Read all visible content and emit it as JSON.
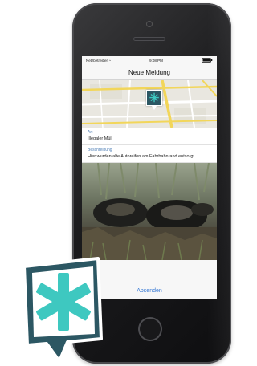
{
  "status_bar": {
    "carrier": "Netzbetreiber",
    "time": "9:08 PM",
    "wifi_icon": "wifi-icon",
    "battery_icon": "battery-icon"
  },
  "nav": {
    "title": "Neue Meldung"
  },
  "map": {
    "pin_icon": "asterisk-icon",
    "pin_color": "#2c5763",
    "asterisk_color": "#3ec8c0"
  },
  "form": {
    "type_label": "Art",
    "type_value": "Illegaler Müll",
    "description_label": "Beschreibung",
    "description_value": "Hier wurden alte Autoreifen am Fahrbahnrand entsorgt"
  },
  "actions": {
    "submit_label": "Absenden"
  },
  "brand": {
    "logo_icon": "asterisk-logo-icon",
    "logo_background": "#2c5763",
    "logo_accent": "#3ec8c0"
  }
}
